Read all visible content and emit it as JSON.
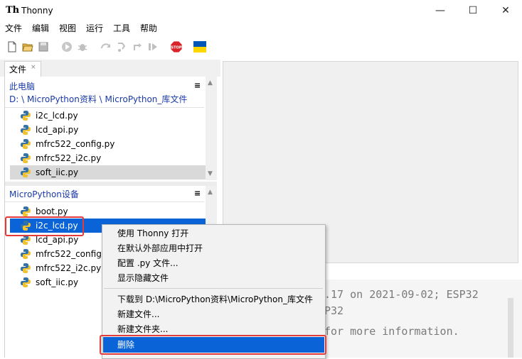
{
  "window": {
    "app_name": "Thonny",
    "logo_text": "Th",
    "minimize_glyph": "—",
    "maximize_glyph": "☐",
    "close_glyph": "✕"
  },
  "menu": [
    "文件",
    "编辑",
    "视图",
    "运行",
    "工具",
    "帮助"
  ],
  "toolbar": {
    "icons": [
      "new-file-icon",
      "open-file-icon",
      "save-file-icon",
      "run-icon",
      "debug-icon",
      "step-over-icon",
      "step-into-icon",
      "step-out-icon",
      "resume-icon",
      "stop-icon",
      "ukraine-flag-icon"
    ],
    "stop_label": "STOP",
    "flag_colors": [
      "#0057b7",
      "#ffd700"
    ]
  },
  "files_tab": {
    "label": "文件",
    "close": "×"
  },
  "local_files": {
    "location_title": "此电脑",
    "path": "D: \\ MicroPython资料 \\ MicroPython_库文件",
    "menu_glyph": "≡",
    "items": [
      "i2c_lcd.py",
      "lcd_api.py",
      "mfrc522_config.py",
      "mfrc522_i2c.py",
      "soft_iic.py"
    ],
    "selected": "soft_iic.py"
  },
  "device_files": {
    "location_title": "MicroPython设备",
    "menu_glyph": "≡",
    "items": [
      "boot.py",
      "i2c_lcd.py",
      "lcd_api.py",
      "mfrc522_config.py",
      "mfrc522_i2c.py",
      "soft_iic.py"
    ],
    "selected": "i2c_lcd.py"
  },
  "shell": {
    "line1": ".17 on 2021-09-02; ESP32",
    "line2": "P32",
    "line3": "for more information."
  },
  "context_menu": {
    "open_with_thonny": "使用 Thonny 打开",
    "open_external": "在默认外部应用中打开",
    "configure_py": "配置 .py 文件...",
    "show_hidden": "显示隐藏文件",
    "download_to": "下载到 D:\\MicroPython资料\\MicroPython_库文件",
    "new_file": "新建文件...",
    "new_folder": "新建文件夹...",
    "delete": "删除"
  },
  "colors": {
    "selection_blue": "#0a64d8",
    "highlight_red": "#e23b3b",
    "location_blue": "#1a3aa8"
  }
}
